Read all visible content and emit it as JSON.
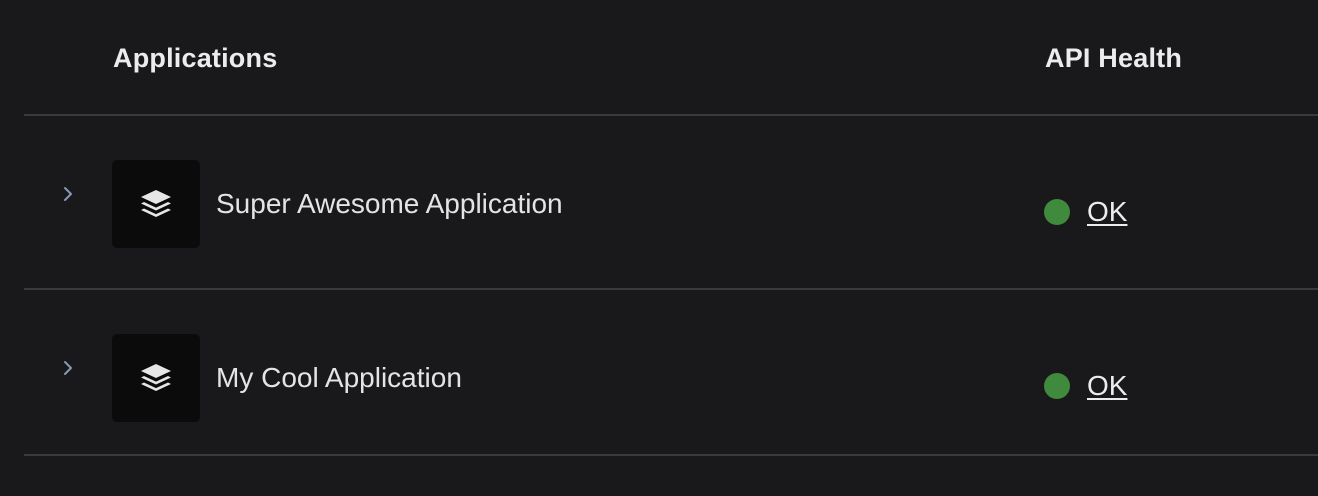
{
  "table": {
    "headers": {
      "applications": "Applications",
      "api_health": "API Health"
    },
    "rows": [
      {
        "name": "Super Awesome Application",
        "icon": "layers-icon",
        "health_status": "OK",
        "health_color": "#3f8a3d"
      },
      {
        "name": "My Cool Application",
        "icon": "layers-icon",
        "health_status": "OK",
        "health_color": "#3f8a3d"
      }
    ]
  },
  "colors": {
    "background": "#19191b",
    "divider": "#3a3a3d",
    "icon_box": "#0b0b0c",
    "chevron": "#8a97b8"
  }
}
